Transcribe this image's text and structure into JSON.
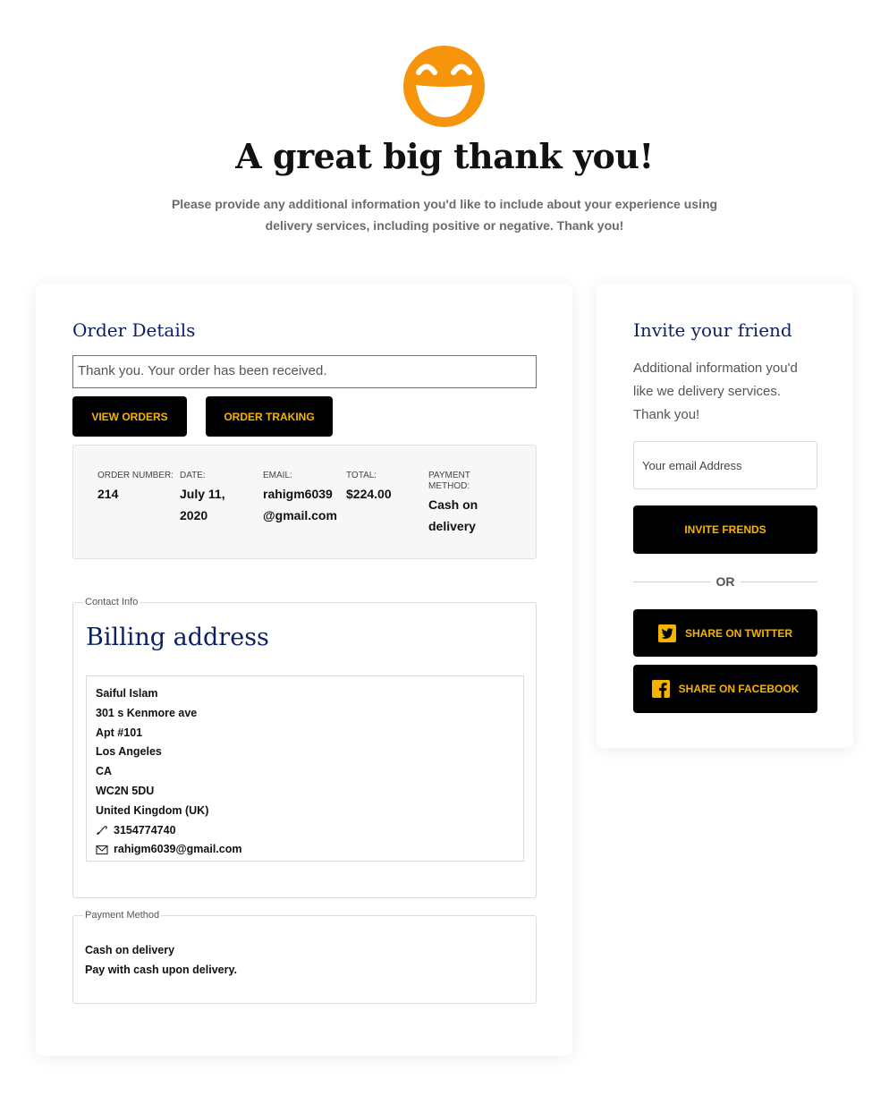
{
  "colors": {
    "accent": "#f4b400",
    "heading": "#0c1f66",
    "success_border": "#2e9c4a",
    "emoji": "#f6950b"
  },
  "hero": {
    "icon": "grinning-face-icon",
    "title": "A great big thank you!",
    "subtitle": "Please provide any additional information you'd like to include about your experience using delivery services, including positive or negative. Thank you!"
  },
  "order": {
    "title": "Order Details",
    "notice": "Thank you. Your order has been received.",
    "view_orders": "VIEW ORDERS",
    "order_tracking": "ORDER TRAKING",
    "summary": [
      {
        "label": "ORDER NUMBER:",
        "value": "214"
      },
      {
        "label": "DATE:",
        "value": "July 11, 2020"
      },
      {
        "label": "EMAIL:",
        "value": "rahigm6039@gmail.com"
      },
      {
        "label": "TOTAL:",
        "value": "$224.00"
      },
      {
        "label": "PAYMENT METHOD:",
        "value": "Cash on delivery"
      }
    ]
  },
  "contact": {
    "legend": "Contact Info",
    "title": "Billing address",
    "name": "Saiful Islam",
    "street": "301 s Kenmore ave",
    "apt": "Apt #101",
    "city": "Los Angeles",
    "state": "CA",
    "postcode": "WC2N 5DU",
    "country": "United Kingdom (UK)",
    "phone": "3154774740",
    "phone_icon": "phone-icon",
    "email": "rahigm6039@gmail.com",
    "email_icon": "envelope-icon"
  },
  "payment": {
    "legend": "Payment Method",
    "method": "Cash on delivery",
    "note": "Pay with cash upon delivery."
  },
  "invite": {
    "title": "Invite your friend",
    "text": "Additional information you'd like we delivery services. Thank you!",
    "email_placeholder": "Your email Address",
    "invite_button": "INVITE FRENDS",
    "or": "OR",
    "twitter_button": "SHARE ON TWITTER",
    "twitter_icon": "twitter-icon",
    "facebook_button": "SHARE ON FACEBOOK",
    "facebook_icon": "facebook-icon"
  }
}
